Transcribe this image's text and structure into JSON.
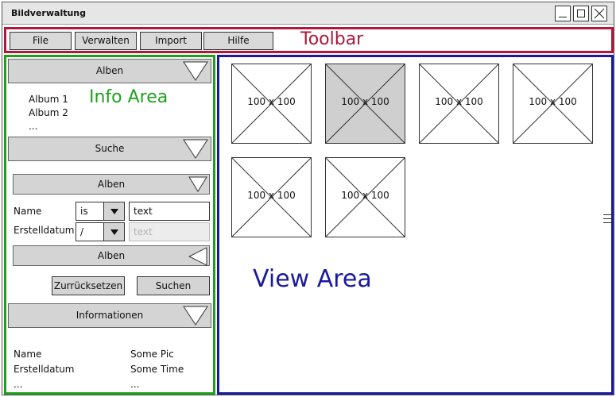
{
  "window": {
    "title": "Bildverwaltung"
  },
  "toolbar": {
    "buttons": [
      "File",
      "Verwalten",
      "Import",
      "Hilfe"
    ],
    "label": "Toolbar",
    "accent_color": "#b0173b"
  },
  "info_area": {
    "label": "Info Area",
    "accent_color": "#1da11d",
    "albums_section": {
      "header": "Alben",
      "items": [
        "Album 1",
        "Album 2",
        "..."
      ]
    },
    "search_section": {
      "header": "Suche",
      "album_filter": "Alben",
      "name_label": "Name",
      "name_operator": "is",
      "name_value": "text",
      "date_label": "Erstelldatum",
      "date_operator": "/",
      "date_placeholder": "text",
      "album_scope": "Alben",
      "reset_button": "Zurrücksetzen",
      "search_button": "Suchen"
    },
    "details_section": {
      "header": "Informationen",
      "rows": [
        {
          "key": "Name",
          "value": "Some Pic"
        },
        {
          "key": "Erstelldatum",
          "value": "Some Time"
        },
        {
          "key": "...",
          "value": "..."
        }
      ]
    }
  },
  "view_area": {
    "label": "View Area",
    "accent_color": "#1a1a9c",
    "thumbnails": [
      {
        "caption": "100 x 100",
        "selected": false
      },
      {
        "caption": "100 x 100",
        "selected": true
      },
      {
        "caption": "100 x 100",
        "selected": false
      },
      {
        "caption": "100 x 100",
        "selected": false
      },
      {
        "caption": "100 x 100",
        "selected": false
      },
      {
        "caption": "100 x 100",
        "selected": false
      }
    ]
  }
}
